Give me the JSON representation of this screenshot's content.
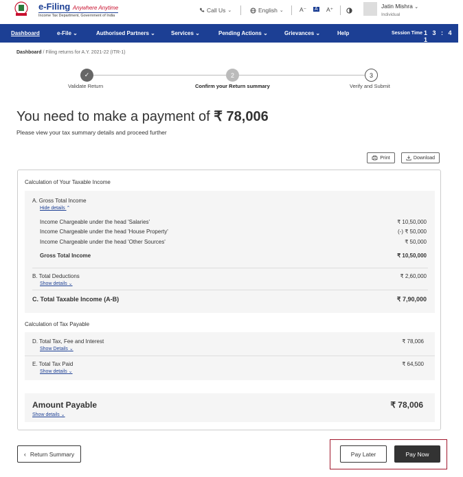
{
  "header": {
    "brand_main": "e-Filing",
    "brand_tagline": "Anywhere Anytime",
    "brand_sub": "Income Tax Department, Government of India",
    "call_us": "Call Us",
    "language": "English",
    "font_decrease": "A⁻",
    "font_normal": "A",
    "font_increase": "A⁺",
    "user_name": "Jatin Mishra",
    "user_role": "Individual"
  },
  "nav": {
    "items": [
      "Dashboard",
      "e-File",
      "Authorised Partners",
      "Services",
      "Pending Actions",
      "Grievances",
      "Help"
    ],
    "session_label": "Session Time",
    "session_time": "1 3 : 4 1"
  },
  "breadcrumb": {
    "root": "Dashboard",
    "current": " / Filing returns for A.Y. 2021-22 (ITR-1)"
  },
  "stepper": {
    "steps": [
      {
        "label": "Validate Return",
        "marker": "✓"
      },
      {
        "label": "Confirm your Return summary",
        "marker": "2"
      },
      {
        "label": "Verify and Submit",
        "marker": "3"
      }
    ]
  },
  "page": {
    "title_prefix": "You need to make a payment of ",
    "title_amount": "₹ 78,006",
    "subtitle": "Please view your tax summary details and proceed further",
    "print_label": "Print",
    "download_label": "Download"
  },
  "income": {
    "section_title": "Calculation of Your Taxable Income",
    "gross_title": "A. Gross Total Income",
    "hide_details": "Hide details",
    "rows": [
      {
        "label": "Income Chargeable under the head 'Salaries'",
        "value": "₹ 10,50,000"
      },
      {
        "label": "Income Chargeable under the head 'House Property'",
        "value": "(-) ₹ 50,000"
      },
      {
        "label": "Income Chargeable under the head 'Other Sources'",
        "value": "₹ 50,000"
      }
    ],
    "gross_total_label": "Gross Total Income",
    "gross_total_value": "₹ 10,50,000",
    "deductions_label": "B. Total Deductions",
    "deductions_value": "₹ 2,60,000",
    "show_details": "Show details",
    "taxable_label": "C. Total Taxable Income (A-B)",
    "taxable_value": "₹ 7,90,000"
  },
  "tax": {
    "section_title": "Calculation of Tax Payable",
    "total_tax_label": "D. Total Tax, Fee and Interest",
    "total_tax_value": "₹ 78,006",
    "show_details_cap": "Show Details",
    "tax_paid_label": "E. Total Tax Paid",
    "tax_paid_value": "₹ 64,500",
    "show_details": "Show details",
    "amount_payable_label": "Amount Payable",
    "amount_payable_value": "₹ 78,006"
  },
  "footer": {
    "return_summary": "Return Summary",
    "pay_later": "Pay Later",
    "pay_now": "Pay Now"
  },
  "colors": {
    "primary": "#1c3f94",
    "highlight": "#a0152a",
    "pay_now_bg": "#333333"
  }
}
